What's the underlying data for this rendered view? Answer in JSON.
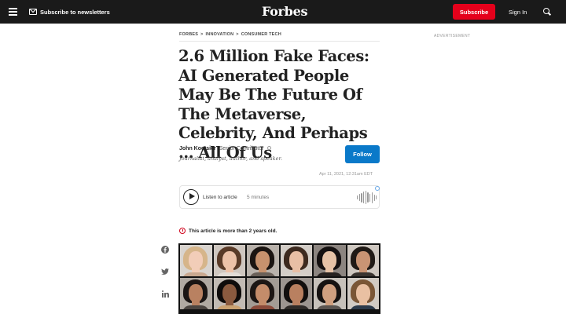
{
  "nav": {
    "newsletter_label": "Subscribe to newsletters",
    "logo": "Forbes",
    "subscribe_label": "Subscribe",
    "signin_label": "Sign In"
  },
  "breadcrumb": [
    "FORBES",
    "INNOVATION",
    "CONSUMER TECH"
  ],
  "breadcrumb_sep": ">",
  "advertisement_label": "ADVERTISEMENT",
  "article": {
    "headline": "2.6 Million Fake Faces: AI Generated People May Be The Future Of The Metaverse, Celebrity, And Perhaps ... All Of Us",
    "author_name": "John Koetsier",
    "author_role": "Senior Contributor",
    "author_bio": "Journalist, analyst, author, and speaker.",
    "follow_label": "Follow",
    "published": "Apr 11, 2021, 12:31am EDT"
  },
  "audio": {
    "label": "Listen to article",
    "duration": "5 minutes"
  },
  "age_notice": "This article is more than 2 years old.",
  "colors": {
    "topbar": "#1a1a1a",
    "subscribe": "#e5001b",
    "follow": "#0a79c9",
    "alert": "#d0021b"
  },
  "share_icons": [
    "facebook-icon",
    "twitter-icon",
    "linkedin-icon"
  ],
  "faces": [
    {
      "bg": "#d9d4cf",
      "hair": "#d6b58a",
      "skin": "#f2cdb8",
      "shirt": "#c9a890"
    },
    {
      "bg": "#cfc7c0",
      "hair": "#5a3b28",
      "skin": "#edc2a8",
      "shirt": "#e2dcd6"
    },
    {
      "bg": "#b9b2ab",
      "hair": "#1b1512",
      "skin": "#c7926e",
      "shirt": "#6a6058"
    },
    {
      "bg": "#d3cdc7",
      "hair": "#3d2a1f",
      "skin": "#e8bfa5",
      "shirt": "#d5cfc8"
    },
    {
      "bg": "#8c8580",
      "hair": "#151111",
      "skin": "#e6c2a6",
      "shirt": "#272220"
    },
    {
      "bg": "#cfc8c1",
      "hair": "#201a16",
      "skin": "#c99474",
      "shirt": "#3a3430"
    },
    {
      "bg": "#b0a9a2",
      "hair": "#1a1514",
      "skin": "#b98161",
      "shirt": "#4a4440"
    },
    {
      "bg": "#c2bbb4",
      "hair": "#0f0c0b",
      "skin": "#8a5a3f",
      "shirt": "#c8a070"
    },
    {
      "bg": "#a39c95",
      "hair": "#1c1614",
      "skin": "#c48c6a",
      "shirt": "#8a4a3a"
    },
    {
      "bg": "#9c9590",
      "hair": "#120f0e",
      "skin": "#b98060",
      "shirt": "#2e2a28"
    },
    {
      "bg": "#c7c1ba",
      "hair": "#161211",
      "skin": "#cf9f7f",
      "shirt": "#5a5450"
    },
    {
      "bg": "#d1cbc4",
      "hair": "#7a5636",
      "skin": "#e9c0a2",
      "shirt": "#2c3a4a"
    }
  ]
}
